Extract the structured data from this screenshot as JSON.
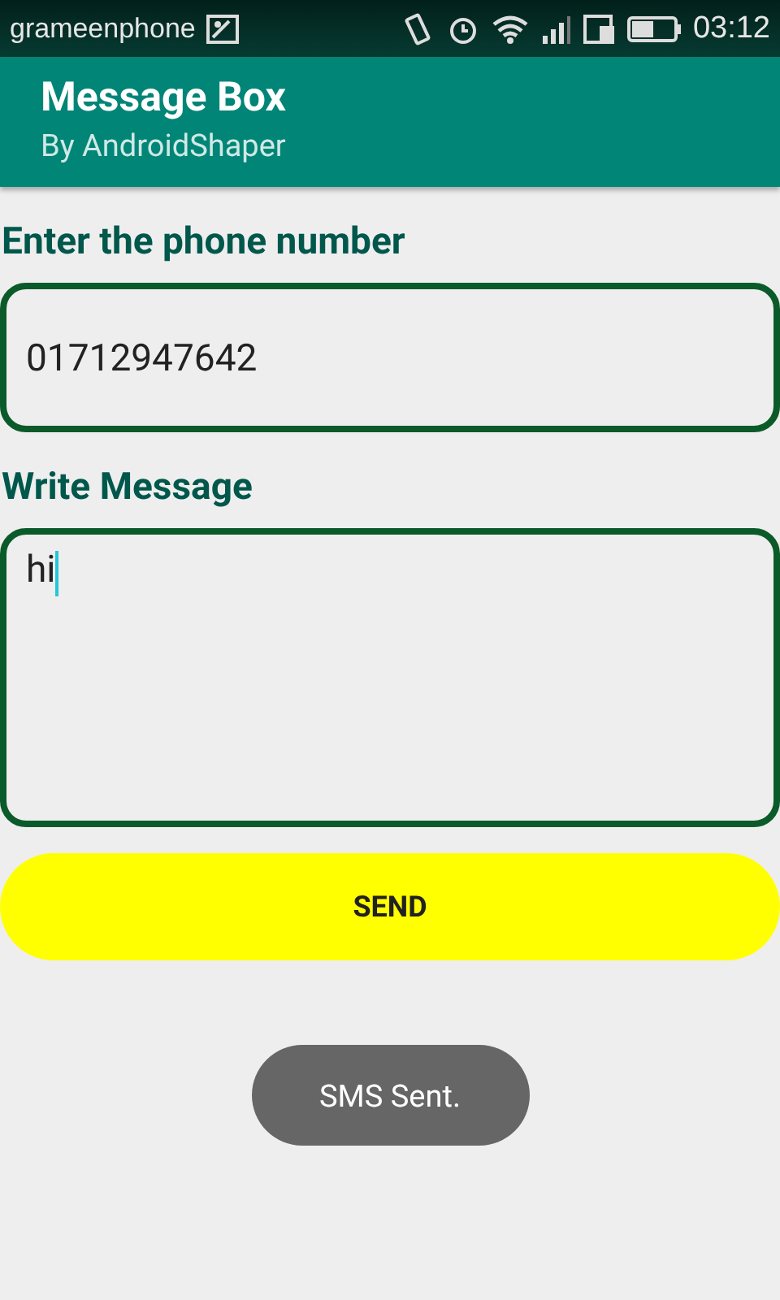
{
  "status_bar": {
    "carrier": "grameenphone",
    "time": "03:12"
  },
  "app_bar": {
    "title": "Message Box",
    "subtitle": "By AndroidShaper"
  },
  "phone_field": {
    "label": "Enter the phone number",
    "value": "01712947642"
  },
  "message_field": {
    "label": "Write Message",
    "value": "hi"
  },
  "send_button": {
    "label": "SEND"
  },
  "toast": {
    "text": "SMS Sent."
  }
}
